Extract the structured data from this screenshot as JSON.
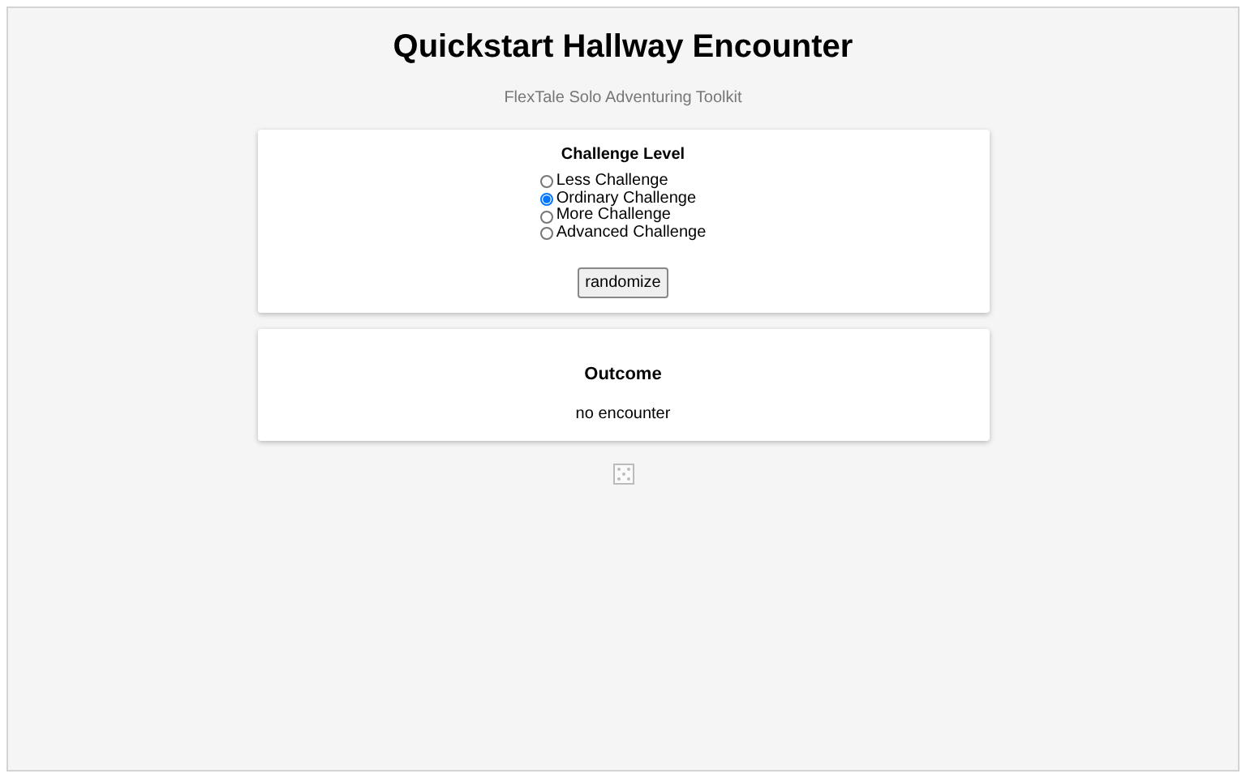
{
  "title": "Quickstart Hallway Encounter",
  "subtitle": "FlexTale Solo Adventuring Toolkit",
  "challenge": {
    "heading": "Challenge Level",
    "options": [
      {
        "label": "Less Challenge",
        "selected": false
      },
      {
        "label": "Ordinary Challenge",
        "selected": true
      },
      {
        "label": "More Challenge",
        "selected": false
      },
      {
        "label": "Advanced Challenge",
        "selected": false
      }
    ],
    "button": "randomize"
  },
  "outcome": {
    "heading": "Outcome",
    "text": "no encounter"
  }
}
